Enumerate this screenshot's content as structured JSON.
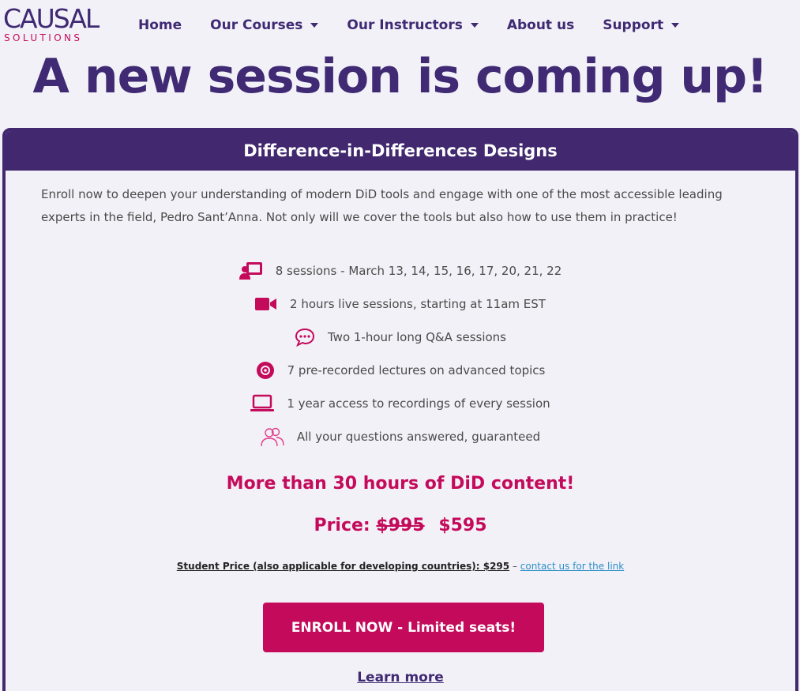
{
  "brand": {
    "logo_main": "CAUSAL",
    "logo_sub": "SOLUTIONS"
  },
  "nav": {
    "home": "Home",
    "courses": "Our Courses",
    "instructors": "Our Instructors",
    "about": "About us",
    "support": "Support"
  },
  "headline": "A new session is coming up!",
  "card": {
    "title": "Difference-in-Differences Designs",
    "intro": "Enroll now to deepen your understanding of modern DiD tools and engage with one of the most accessible leading experts in the field, Pedro Sant’Anna. Not only will we cover the tools but also how to use them in practice!",
    "features": [
      {
        "icon": "presentation-icon",
        "text": "8 sessions - March 13, 14, 15, 16, 17, 20, 21, 22"
      },
      {
        "icon": "video-camera-icon",
        "text": "2 hours live sessions, starting at 11am EST"
      },
      {
        "icon": "chat-bubble-icon",
        "text": "Two 1-hour long Q&A sessions"
      },
      {
        "icon": "disc-icon",
        "text": "7 pre-recorded lectures on advanced topics"
      },
      {
        "icon": "laptop-icon",
        "text": "1 year access to recordings of every session"
      },
      {
        "icon": "users-icon",
        "text": "All your questions answered, guaranteed"
      }
    ],
    "highlight": "More than 30 hours of DiD content!",
    "price_label": "Price:",
    "price_old": "$995",
    "price_new": "$595",
    "student_text": "Student Price (also applicable for developing countries): $295",
    "student_dash": " – ",
    "student_link": "contact us for the link",
    "enroll_button": "ENROLL NOW - Limited seats!",
    "learn_more": "Learn more"
  },
  "colors": {
    "primary": "#42296f",
    "accent": "#c40b5b",
    "link": "#2a8fc7",
    "background": "#f3f1f8"
  }
}
